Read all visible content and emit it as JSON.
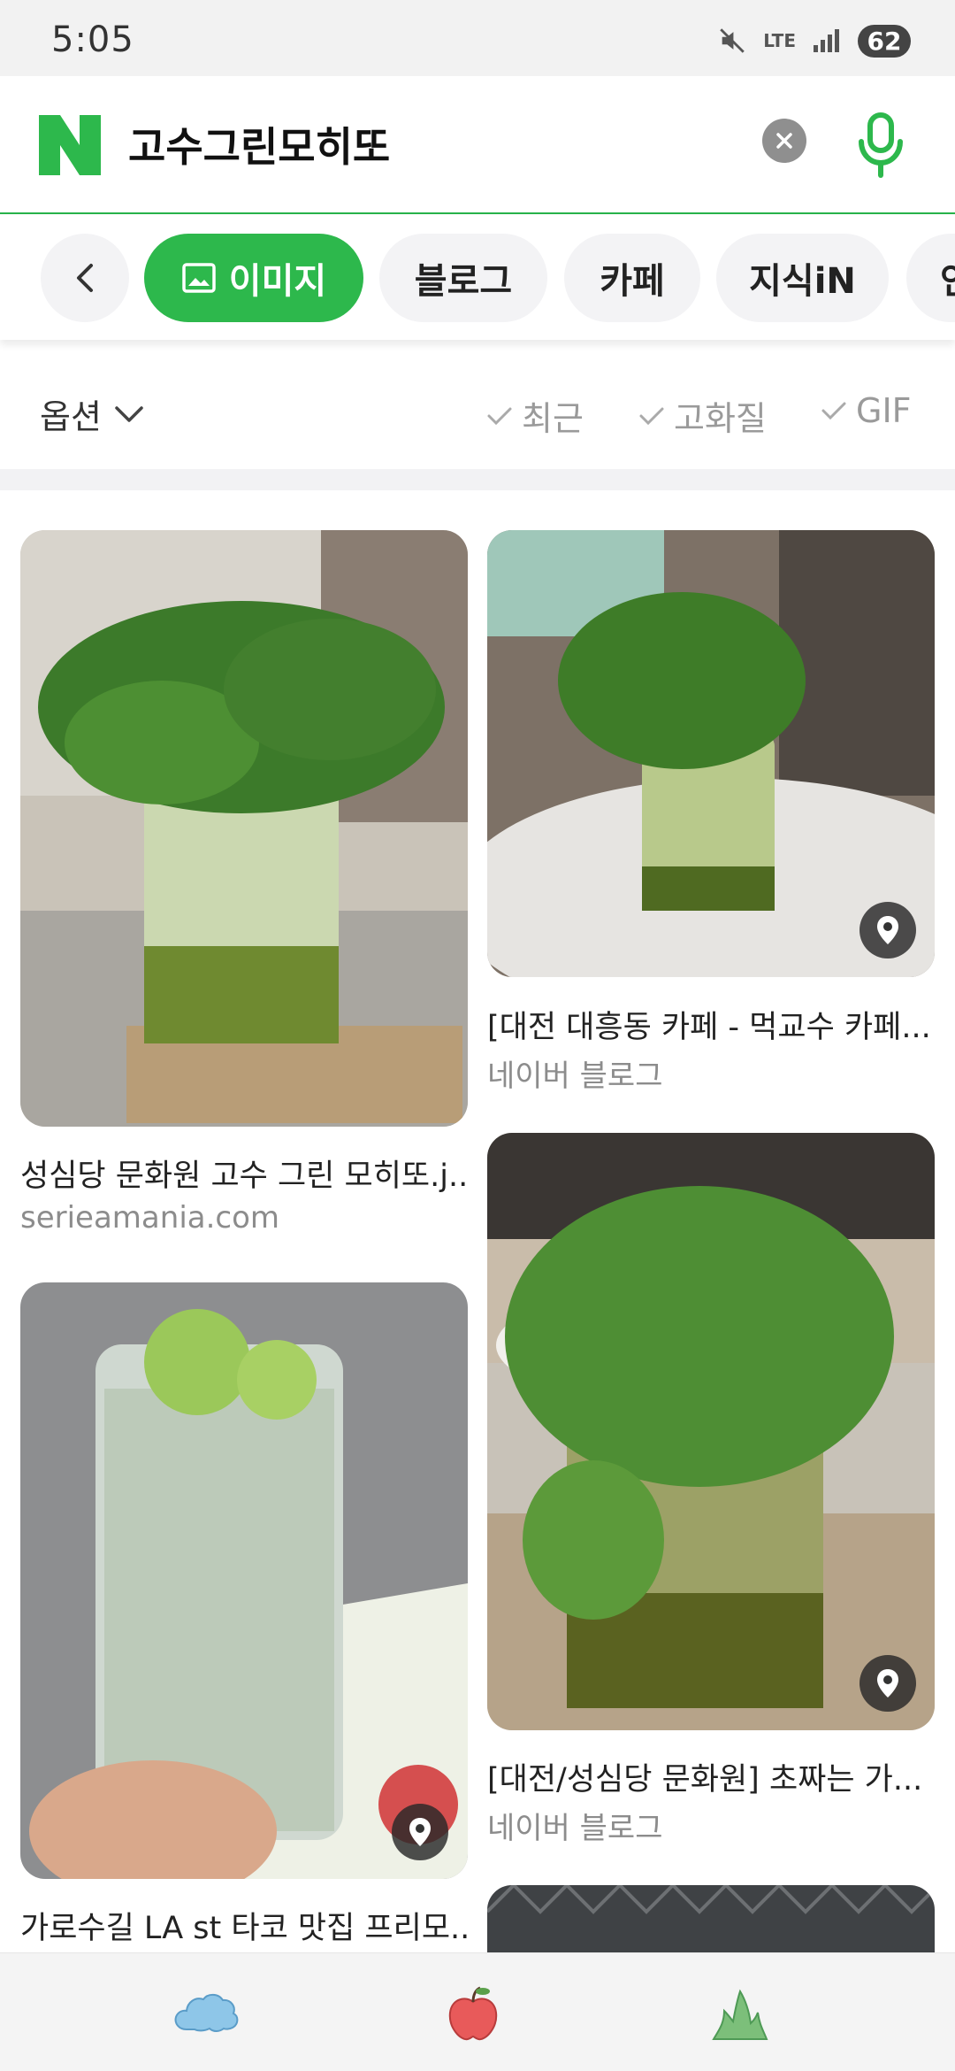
{
  "status_bar": {
    "time": "5:05",
    "network": "LTE",
    "battery": "62"
  },
  "search": {
    "query": "고수그린모히또"
  },
  "tabs": [
    {
      "label": "이미지",
      "active": true
    },
    {
      "label": "블로그"
    },
    {
      "label": "카페"
    },
    {
      "label": "지식iN"
    },
    {
      "label": "인"
    }
  ],
  "options": {
    "label": "옵션",
    "filters": [
      "최근",
      "고화질",
      "GIF"
    ]
  },
  "results": [
    {
      "title": "성심당 문화원 고수 그린 모히또.j...",
      "source": "serieamania.com"
    },
    {
      "title": "[대전 대흥동 카페 - 먹교수 카페...",
      "source": "네이버 블로그"
    },
    {
      "title": "가로수길 LA st 타코 맛집 프리모...",
      "source": ""
    },
    {
      "title": "[대전/성심당 문화원] 초짜는 가...",
      "source": "네이버 블로그"
    }
  ],
  "bottom_nav": [
    "cloud-icon",
    "apple-icon",
    "plant-icon"
  ],
  "colors": {
    "brand_green": "#2db84c",
    "header_line": "#27b24a"
  }
}
